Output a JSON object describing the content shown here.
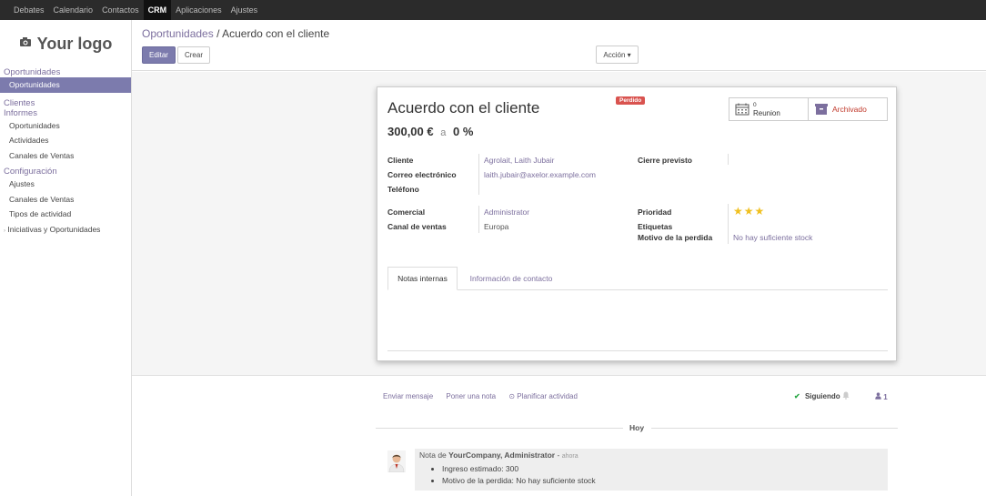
{
  "topmenu": [
    "Debates",
    "Calendario",
    "Contactos",
    "CRM",
    "Aplicaciones",
    "Ajustes"
  ],
  "logo_text": "Your logo",
  "sidebar": {
    "sec_oportunidades": "Oportunidades",
    "item_oportunidades": "Oportunidades",
    "sec_clientes": "Clientes",
    "sec_informes": "Informes",
    "informes_items": [
      "Oportunidades",
      "Actividades",
      "Canales de Ventas"
    ],
    "sec_configuracion": "Configuración",
    "config_items": [
      "Ajustes",
      "Canales de Ventas",
      "Tipos de actividad"
    ],
    "iniciativas": "Iniciativas y Oportunidades"
  },
  "breadcrumb": {
    "parent": "Oportunidades",
    "sep": "/",
    "current": "Acuerdo con el cliente"
  },
  "buttons": {
    "edit": "Editar",
    "create": "Crear",
    "action": "Acción ▾"
  },
  "record": {
    "title": "Acuerdo con el cliente",
    "amount": "300,00 €",
    "a": "a",
    "probability": "0 %",
    "ribbon": "Perdido",
    "meetings_count": "0",
    "meetings_label": "Reunion",
    "archived_label": "Archivado",
    "fields": {
      "cliente_label": "Cliente",
      "cliente_value": "Agrolait, Laith Jubair",
      "email_label": "Correo electrónico",
      "email_value": "laith.jubair@axelor.example.com",
      "telefono_label": "Teléfono",
      "cierre_label": "Cierre previsto",
      "comercial_label": "Comercial",
      "comercial_value": "Administrator",
      "canal_label": "Canal de ventas",
      "canal_value": "Europa",
      "prioridad_label": "Prioridad",
      "etiquetas_label": "Etiquetas",
      "motivo_label": "Motivo de la perdida",
      "motivo_value": "No hay suficiente stock"
    },
    "priority_stars": "★★★",
    "priority_level": 3
  },
  "tabs": [
    "Notas internas",
    "Información de contacto"
  ],
  "chatter": {
    "send_message": "Enviar mensaje",
    "log_note": "Poner una nota",
    "schedule": "⊙ Planificar actividad",
    "following": "Siguiendo",
    "followers": "1",
    "day": "Hoy",
    "note_prefix": "Nota de",
    "note_author": "YourCompany, Administrator",
    "note_sep": "-",
    "note_time": "ahora",
    "note_lines": [
      "Ingreso estimado: 300",
      "Motivo de la perdida: No hay suficiente stock"
    ]
  },
  "colors": {
    "brand": "#7c7bad",
    "topbar": "#2b2b2b",
    "ribbon": "#d9534f",
    "star": "#f0c020"
  }
}
